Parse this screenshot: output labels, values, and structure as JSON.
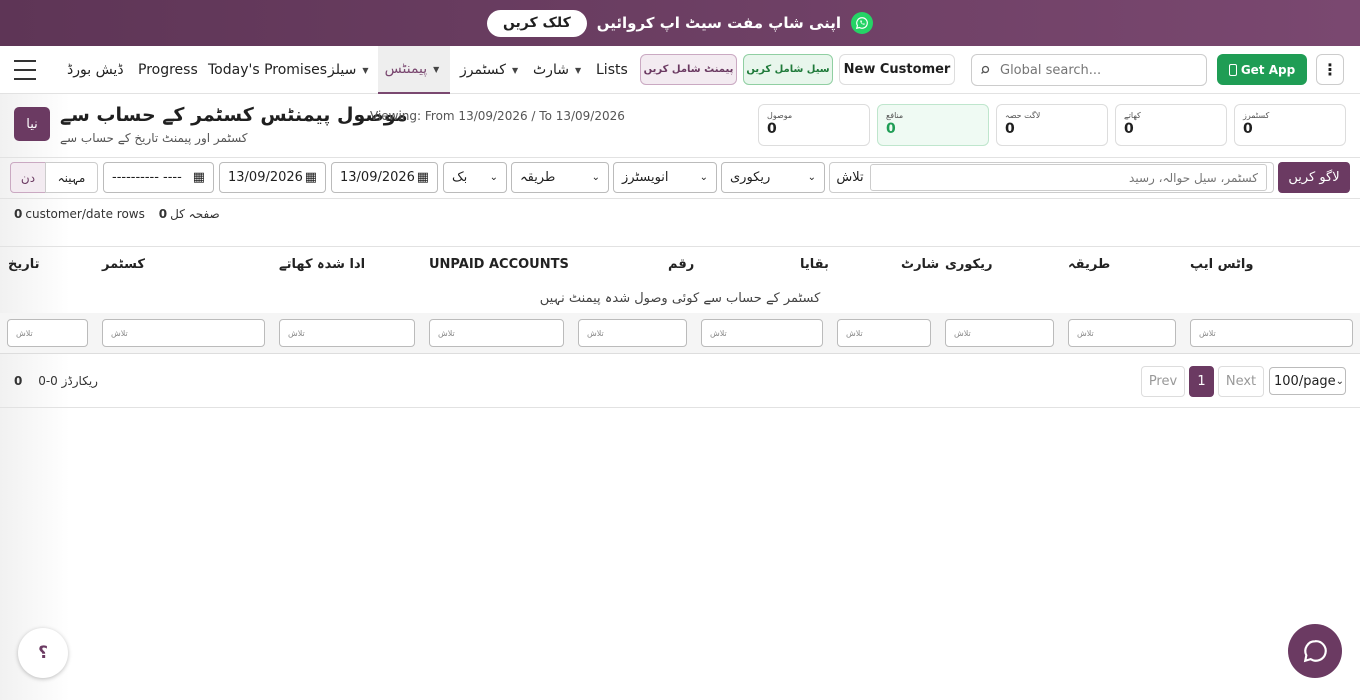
{
  "banner": {
    "cta_label": "کلک کریں",
    "message": "اپنی شاپ مفت سیٹ اپ کروائیں"
  },
  "nav": {
    "items": [
      {
        "label": "ڈیش بورڈ"
      },
      {
        "label": "Progress"
      },
      {
        "label": "Today's Promises"
      },
      {
        "label": "سیلز"
      },
      {
        "label": "پیمنٹس"
      },
      {
        "label": "کسٹمرز"
      },
      {
        "label": "شارٹ"
      },
      {
        "label": "Lists"
      }
    ],
    "add_payment": "پیمنٹ شامل کریں",
    "add_sale": "سیل شامل کریں",
    "new_customer": "New Customer",
    "search_placeholder": "Global search...",
    "get_app": "Get App"
  },
  "header": {
    "new_button": "نیا",
    "title": "موصول پیمنٹس کسٹمر کے حساب سے",
    "viewing": "Viewing: From 13/09/2026 / To 13/09/2026",
    "subtitle": "کسٹمر اور پیمنٹ تاریخ کے حساب سے"
  },
  "stats": [
    {
      "label": "موصول",
      "value": "0"
    },
    {
      "label": "منافع",
      "value": "0"
    },
    {
      "label": "لاگت حصہ",
      "value": "0"
    },
    {
      "label": "کھاتے",
      "value": "0"
    },
    {
      "label": "کسٹمرز",
      "value": "0"
    }
  ],
  "filters": {
    "day": "دن",
    "month": "مہینہ",
    "date_empty": "---------- ----",
    "date_from": "13/09/2026",
    "date_to": "13/09/2026",
    "bank": "بک",
    "method": "طریقہ",
    "investors": "انویسٹرز",
    "recovery": "ریکوری",
    "search_label": "تلاش",
    "search_placeholder": "کسٹمر، سیل حوالہ، رسید",
    "apply": "لاگو کریں"
  },
  "counts": {
    "rows_value": "0",
    "rows_label": "customer/date rows",
    "total_value": "0",
    "total_label": "صفحہ کل"
  },
  "table": {
    "columns": [
      "تاریخ",
      "کسٹمر",
      "ادا شدہ کھاتے",
      "UNPAID ACCOUNTS",
      "رقم",
      "بقایا",
      "شارٹ",
      "ریکوری",
      "طریقہ",
      "واٹس ایپ"
    ],
    "empty_message": "کسٹمر کے حساب سے کوئی وصول شدہ پیمنٹ نہیں",
    "filter_placeholder": "تلاش"
  },
  "pager": {
    "records_value": "0",
    "records_label": "0-0 ریکارڈز",
    "prev": "Prev",
    "page": "1",
    "next": "Next",
    "per_page": "100/page"
  },
  "colors": {
    "accent": "#6b3a62",
    "success": "#1f9d55",
    "banner": "#6b3e63"
  },
  "widgets": {
    "help": "؟"
  }
}
